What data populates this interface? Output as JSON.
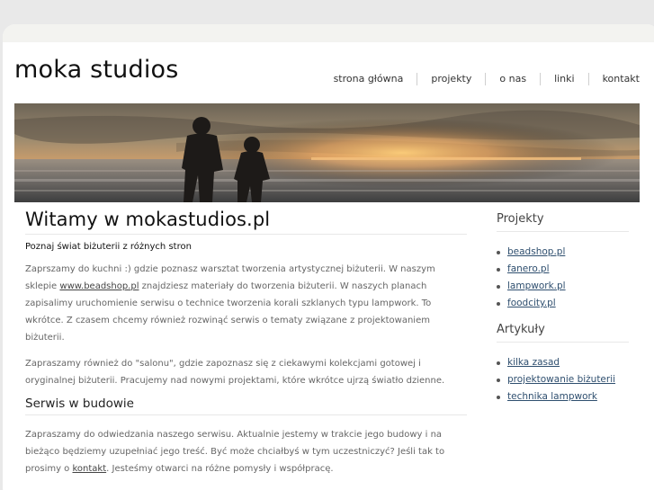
{
  "header": {
    "brand": "moka studios",
    "nav": [
      "strona główna",
      "projekty",
      "o nas",
      "linki",
      "kontakt"
    ]
  },
  "main": {
    "title": "Witamy w mokastudios.pl",
    "subtitle": "Poznaj świat biżuterii z różnych stron",
    "p1_before": "Zaprszamy do kuchni :) gdzie poznasz warsztat tworzenia artystycznej biżuterii. W naszym sklepie ",
    "p1_link": "www.beadshop.pl",
    "p1_after": " znajdziesz materiały do tworzenia biżuterii. W naszych planach zapisalimy uruchomienie serwisu o technice tworzenia korali szklanych typu lampwork. To wkrótce. Z czasem chcemy również rozwinąć serwis o tematy związane z projektowaniem biżuterii.",
    "p2": "Zapraszamy również do \"salonu\", gdzie zapoznasz się z ciekawymi kolekcjami gotowej i oryginalnej biżuterii. Pracujemy nad nowymi projektami, które wkrótce ujrzą światło dzienne.",
    "section_title": "Serwis w budowie",
    "p3_before": "Zapraszamy do odwiedzania naszego serwisu. Aktualnie jestemy w trakcie jego budowy i na bieżąco będziemy uzupełniać jego treść. Być może chciałbyś w tym uczestniczyć? Jeśli tak to prosimy o ",
    "p3_link": "kontakt",
    "p3_after": ". Jesteśmy otwarci na różne pomysły i współpracę."
  },
  "sidebar": {
    "projects_title": "Projekty",
    "projects": [
      "beadshop.pl",
      "fanero.pl",
      "lampwork.pl",
      "foodcity.pl"
    ],
    "articles_title": "Artykuły",
    "articles": [
      "kilka zasad",
      "projektowanie biżuterii",
      "technika lampwork"
    ]
  }
}
